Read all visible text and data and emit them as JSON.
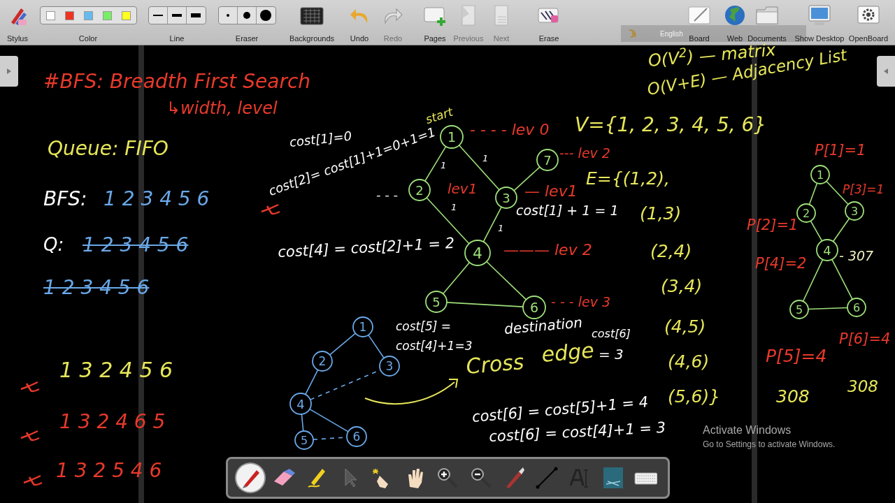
{
  "toolbar": {
    "tools": [
      {
        "label": "Stylus",
        "kind": "stylus",
        "disabled": false
      },
      {
        "label": "Color",
        "kind": "color",
        "disabled": false,
        "swatches": [
          {
            "color": "#ffffff"
          },
          {
            "color": "#ee3322"
          },
          {
            "color": "#66bbee"
          },
          {
            "color": "#77ee66"
          },
          {
            "color": "#ffff22"
          }
        ]
      },
      {
        "label": "Line",
        "kind": "line",
        "disabled": false
      },
      {
        "label": "Eraser",
        "kind": "eraser",
        "disabled": false
      },
      {
        "label": "Backgrounds",
        "kind": "backgrounds",
        "disabled": false
      },
      {
        "label": "Undo",
        "kind": "undo",
        "disabled": false
      },
      {
        "label": "Redo",
        "kind": "redo",
        "disabled": true
      },
      {
        "label": "Pages",
        "kind": "pages",
        "disabled": false
      },
      {
        "label": "Previous",
        "kind": "previous",
        "disabled": true
      },
      {
        "label": "Next",
        "kind": "next",
        "disabled": true
      },
      {
        "label": "Erase",
        "kind": "erase",
        "disabled": false
      },
      {
        "label": "Board",
        "kind": "board",
        "disabled": false
      },
      {
        "label": "Web",
        "kind": "web",
        "disabled": false
      },
      {
        "label": "Documents",
        "kind": "documents",
        "disabled": false
      },
      {
        "label": "Show Desktop",
        "kind": "desktop",
        "disabled": false
      },
      {
        "label": "OpenBoard",
        "kind": "openboard",
        "disabled": false
      }
    ],
    "keyboard_bar": {
      "language": "English"
    }
  },
  "canvas": {
    "notes": [
      {
        "text": "O(V$^{2}$) — matrix",
        "color": "#e6e65a"
      },
      {
        "text": "#BFS: Breadth First Search",
        "color": "#e8392b"
      },
      {
        "text": "O(V+E) — Adjacency List",
        "color": "#e6e65a"
      },
      {
        "text": "↳width, level",
        "color": "#e8392b"
      },
      {
        "text": "start",
        "color": "#e6e65a"
      },
      {
        "text": "- - - - lev 0",
        "color": "#e8392b"
      },
      {
        "text": "V={1, 2, 3, 4, 5, 6}",
        "color": "#e6e65a"
      },
      {
        "text": "cost[1]=0",
        "color": "#ffffff"
      },
      {
        "text": "Queue: FIFO",
        "color": "#e6e65a"
      },
      {
        "text": "--- lev 2",
        "color": "#e8392b"
      },
      {
        "text": "P[1]=1",
        "color": "#e8392b"
      },
      {
        "text": "1",
        "color": "#ffffff"
      },
      {
        "text": "1",
        "color": "#ffffff"
      },
      {
        "text": "E={(1,2),",
        "color": "#e6e65a"
      },
      {
        "text": "BFS:",
        "color": "#ffffff"
      },
      {
        "text": "1  2  3  4  5  6",
        "color": "#6aa8e8"
      },
      {
        "text": "cost[2]= cost[1]+1=0+1=1",
        "color": "#ffffff"
      },
      {
        "text": "- - -",
        "color": "#ffffff"
      },
      {
        "text": "lev1",
        "color": "#e8392b"
      },
      {
        "text": "1",
        "color": "#ffffff"
      },
      {
        "text": "— lev1",
        "color": "#e8392b"
      },
      {
        "text": "cost[1] + 1 = 1",
        "color": "#ffffff"
      },
      {
        "text": "(1,3)",
        "color": "#e6e65a"
      },
      {
        "text": "P[3]=1",
        "color": "#e8392b"
      },
      {
        "text": "1",
        "color": "#ffffff"
      },
      {
        "text": "P[2]=1",
        "color": "#e8392b"
      },
      {
        "text": "Q:",
        "color": "#ffffff"
      },
      {
        "text": "1  2  3  4  5  6",
        "color": "#6aa8e8",
        "crossed": true
      },
      {
        "text": "cost[4] =  cost[2]+1 = 2",
        "color": "#ffffff"
      },
      {
        "text": "——— lev 2",
        "color": "#e8392b"
      },
      {
        "text": "(2,4)",
        "color": "#e6e65a"
      },
      {
        "text": "P[4]=2",
        "color": "#e8392b"
      },
      {
        "text": "- 307",
        "color": "#f0f0c0"
      },
      {
        "text": "1  2  3  4  5  6",
        "color": "#6aa8e8",
        "crossed": true
      },
      {
        "text": "(3,4)",
        "color": "#e6e65a"
      },
      {
        "text": "- - - lev 3",
        "color": "#e8392b"
      },
      {
        "text": "cost[5] =",
        "color": "#ffffff"
      },
      {
        "text": "destination",
        "color": "#ffffff"
      },
      {
        "text": "cost[6]",
        "color": "#ffffff"
      },
      {
        "text": "(4,5)",
        "color": "#e6e65a"
      },
      {
        "text": "P[6]=4",
        "color": "#e8392b"
      },
      {
        "text": "1  3  2  4  5  6",
        "color": "#e6e65a"
      },
      {
        "text": "cost[4]+1=3",
        "color": "#ffffff"
      },
      {
        "text": "Cross",
        "color": "#e6e65a"
      },
      {
        "text": "edge",
        "color": "#e6e65a"
      },
      {
        "text": "= 3",
        "color": "#ffffff"
      },
      {
        "text": "(4,6)",
        "color": "#e6e65a"
      },
      {
        "text": "P[5]=4",
        "color": "#e8392b"
      },
      {
        "text": "(5,6)}",
        "color": "#e6e65a"
      },
      {
        "text": "308",
        "color": "#e6e65a"
      },
      {
        "text": "308",
        "color": "#e6e65a"
      },
      {
        "text": "1  3  2  4  6  5",
        "color": "#e8392b"
      },
      {
        "text": "cost[6] = cost[5]+1 = 4",
        "color": "#ffffff"
      },
      {
        "text": "cost[6] = cost[4]+1 = 3",
        "color": "#ffffff"
      },
      {
        "text": "1  3  2  5  4  6",
        "color": "#e8392b"
      }
    ],
    "graphs": [
      {
        "color": "#9ee07a",
        "nodes": [
          {
            "label": "1"
          },
          {
            "label": "2"
          },
          {
            "label": "3"
          },
          {
            "label": "4"
          },
          {
            "label": "5"
          },
          {
            "label": "6"
          },
          {
            "label": "7"
          }
        ]
      },
      {
        "color": "#6aa8e8",
        "nodes": [
          {
            "label": "1"
          },
          {
            "label": "2"
          },
          {
            "label": "3"
          },
          {
            "label": "4"
          },
          {
            "label": "5"
          },
          {
            "label": "6"
          }
        ]
      },
      {
        "color": "#9ee07a",
        "nodes": [
          {
            "label": "1"
          },
          {
            "label": "2"
          },
          {
            "label": "3"
          },
          {
            "label": "4"
          },
          {
            "label": "5"
          },
          {
            "label": "6"
          }
        ]
      }
    ]
  },
  "activation_notice": {
    "title": "Activate Windows",
    "subtitle": "Go to Settings to activate Windows."
  },
  "dock": {
    "tools": [
      {
        "kind": "pen",
        "selected": true
      },
      {
        "kind": "eraser",
        "selected": false
      },
      {
        "kind": "marker",
        "selected": false
      },
      {
        "kind": "pointer",
        "selected": false
      },
      {
        "kind": "play",
        "selected": false
      },
      {
        "kind": "hand",
        "selected": false
      },
      {
        "kind": "zoom-in",
        "selected": false
      },
      {
        "kind": "zoom-out",
        "selected": false
      },
      {
        "kind": "laser",
        "selected": false
      },
      {
        "kind": "line",
        "selected": false
      },
      {
        "kind": "text",
        "selected": false
      },
      {
        "kind": "capture",
        "selected": false
      },
      {
        "kind": "keyboard",
        "selected": false
      }
    ]
  }
}
